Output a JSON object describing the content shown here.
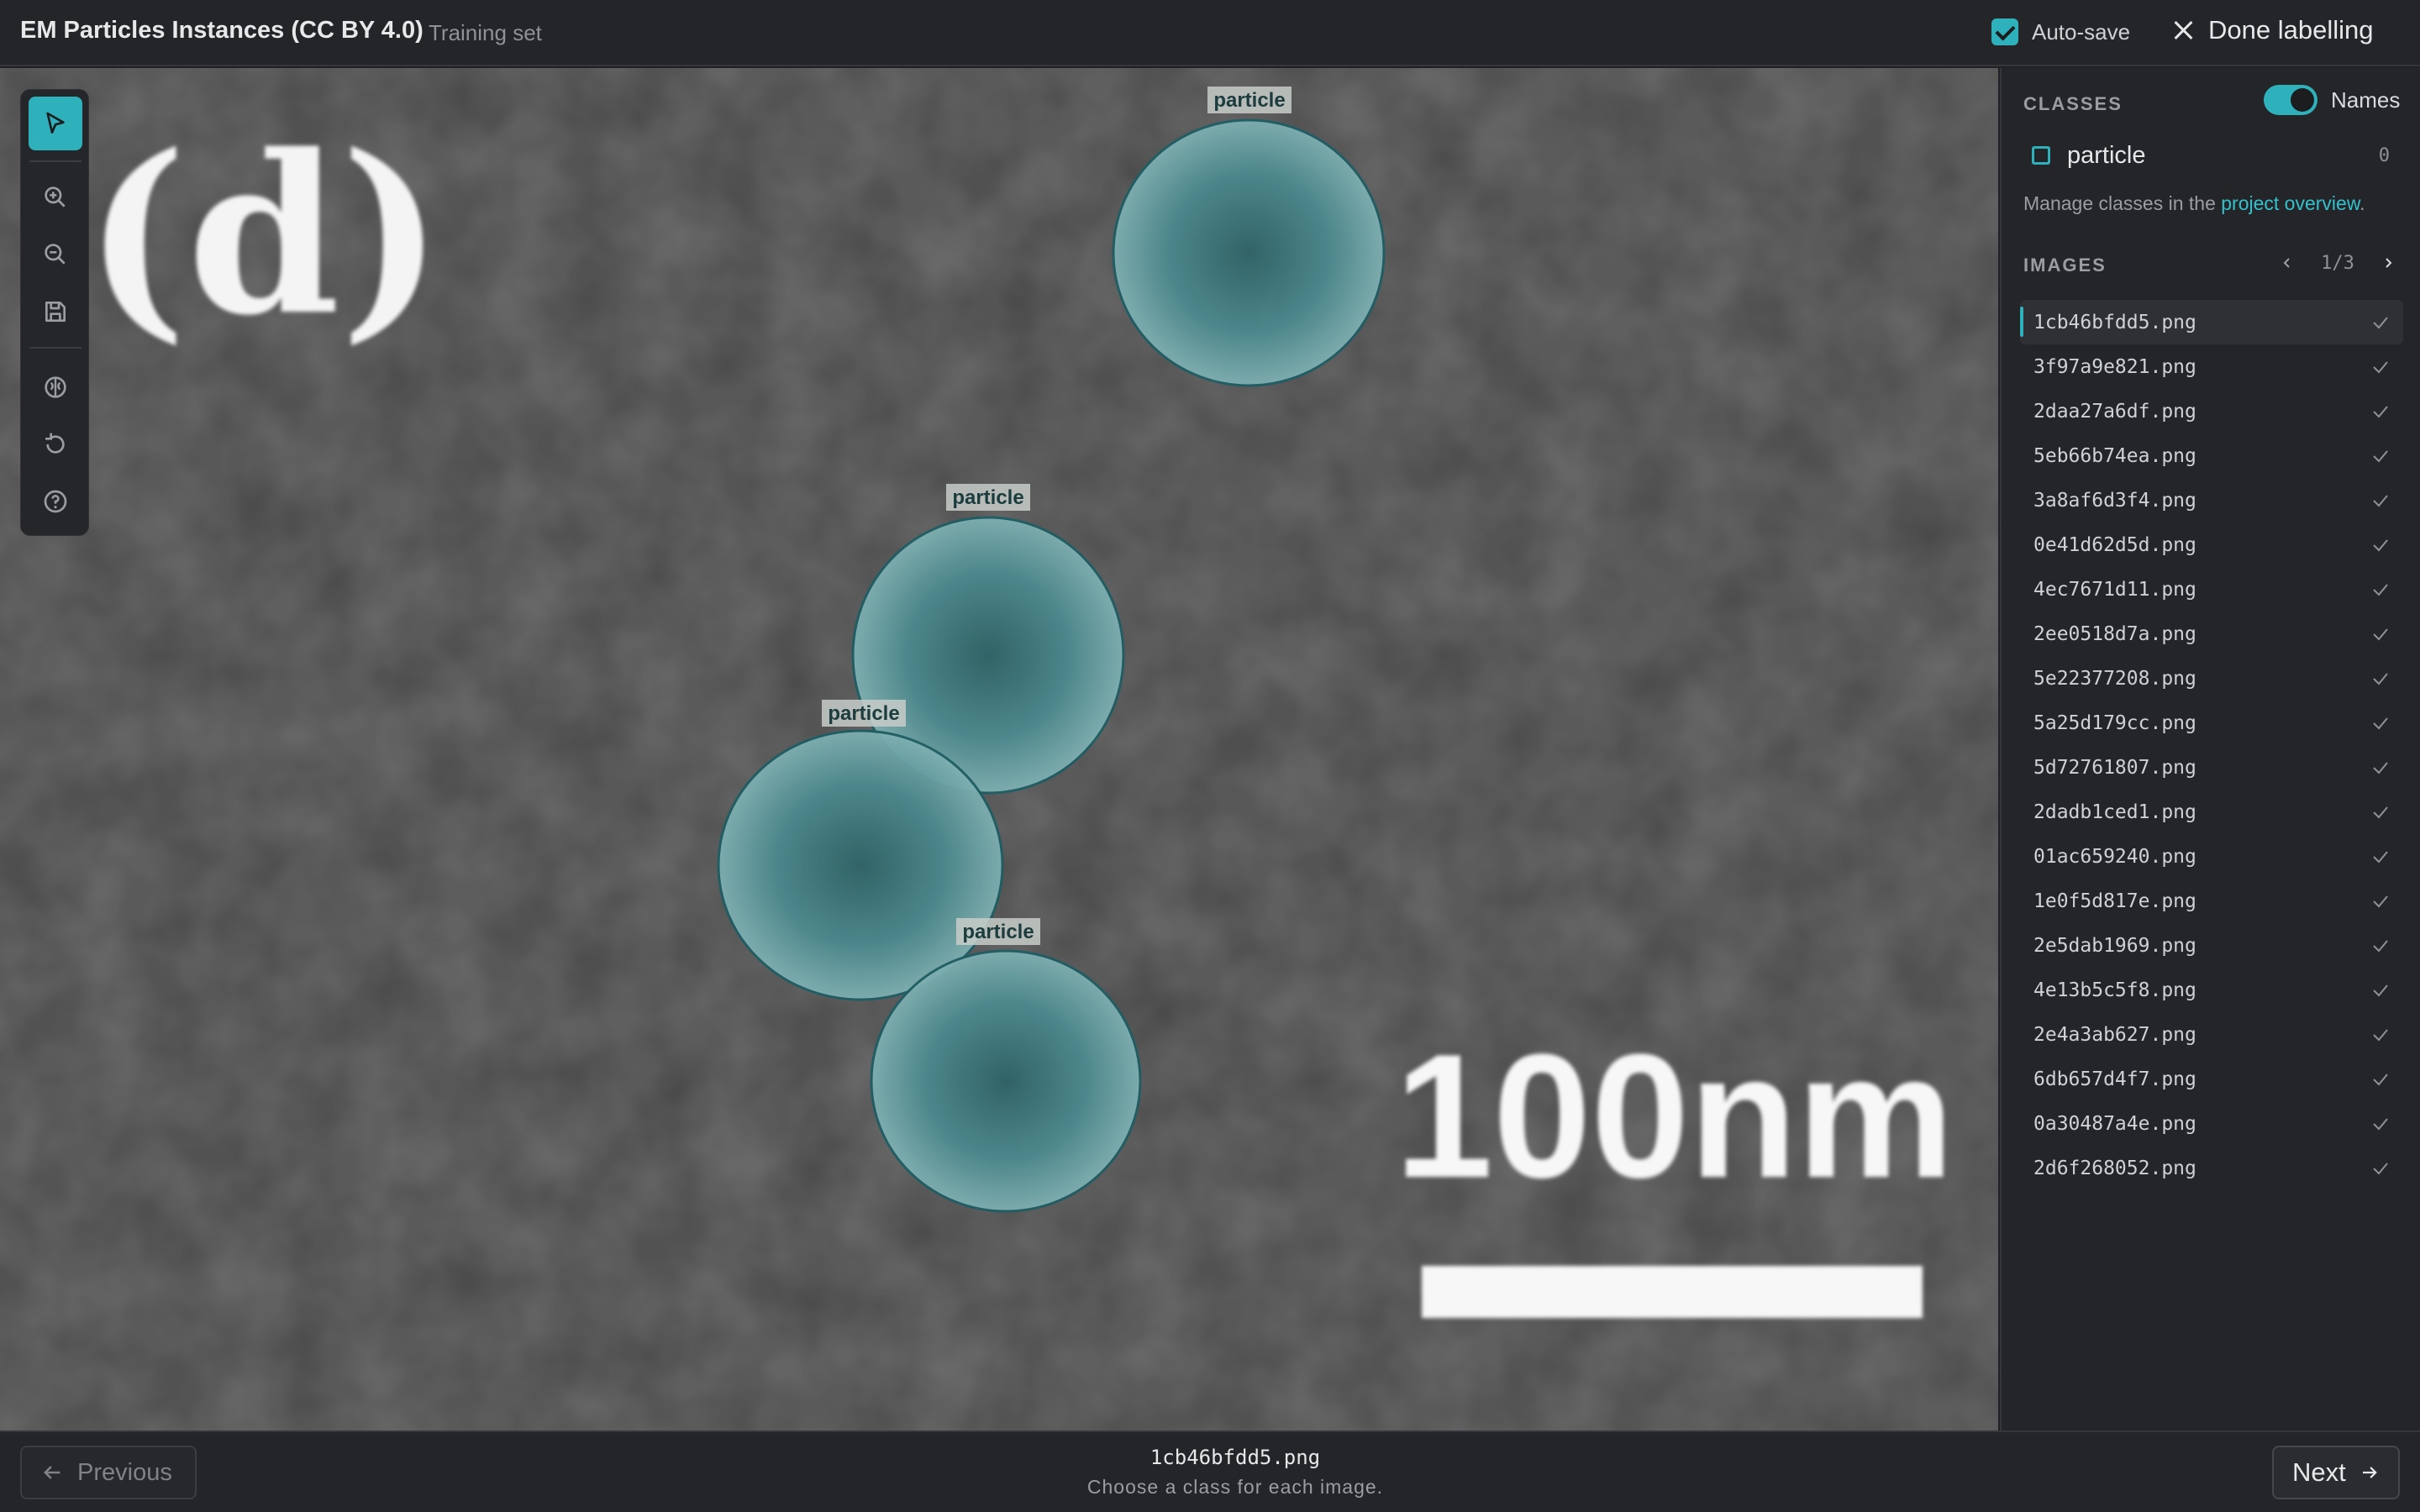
{
  "header": {
    "title": "EM Particles Instances (CC BY 4.0)",
    "subtitle": "Training set",
    "autosave_label": "Auto-save",
    "done_label": "Done labelling"
  },
  "canvas": {
    "panel_label": "(d)",
    "scale_text": "100nm",
    "annotation_label": "particle",
    "annotation_color": "#2fb1bc"
  },
  "tools": [
    "select-tool",
    "zoom-in-tool",
    "zoom-out-tool",
    "save-tool",
    "ai-assist-tool",
    "reset-tool",
    "help-tool"
  ],
  "sidebar": {
    "classes_heading": "CLASSES",
    "names_label": "Names",
    "class": {
      "name": "particle",
      "count": "0"
    },
    "manage_text": "Manage classes in the ",
    "manage_link": "project overview",
    "manage_suffix": ".",
    "images_heading": "IMAGES",
    "page": "1/3",
    "images": [
      "1cb46bfdd5.png",
      "3f97a9e821.png",
      "2daa27a6df.png",
      "5eb66b74ea.png",
      "3a8af6d3f4.png",
      "0e41d62d5d.png",
      "4ec7671d11.png",
      "2ee0518d7a.png",
      "5e22377208.png",
      "5a25d179cc.png",
      "5d72761807.png",
      "2dadb1ced1.png",
      "01ac659240.png",
      "1e0f5d817e.png",
      "2e5dab1969.png",
      "4e13b5c5f8.png",
      "2e4a3ab627.png",
      "6db657d4f7.png",
      "0a30487a4e.png",
      "2d6f268052.png"
    ]
  },
  "footer": {
    "previous_label": "Previous",
    "next_label": "Next",
    "current_file": "1cb46bfdd5.png",
    "hint": "Choose a class for each image."
  }
}
